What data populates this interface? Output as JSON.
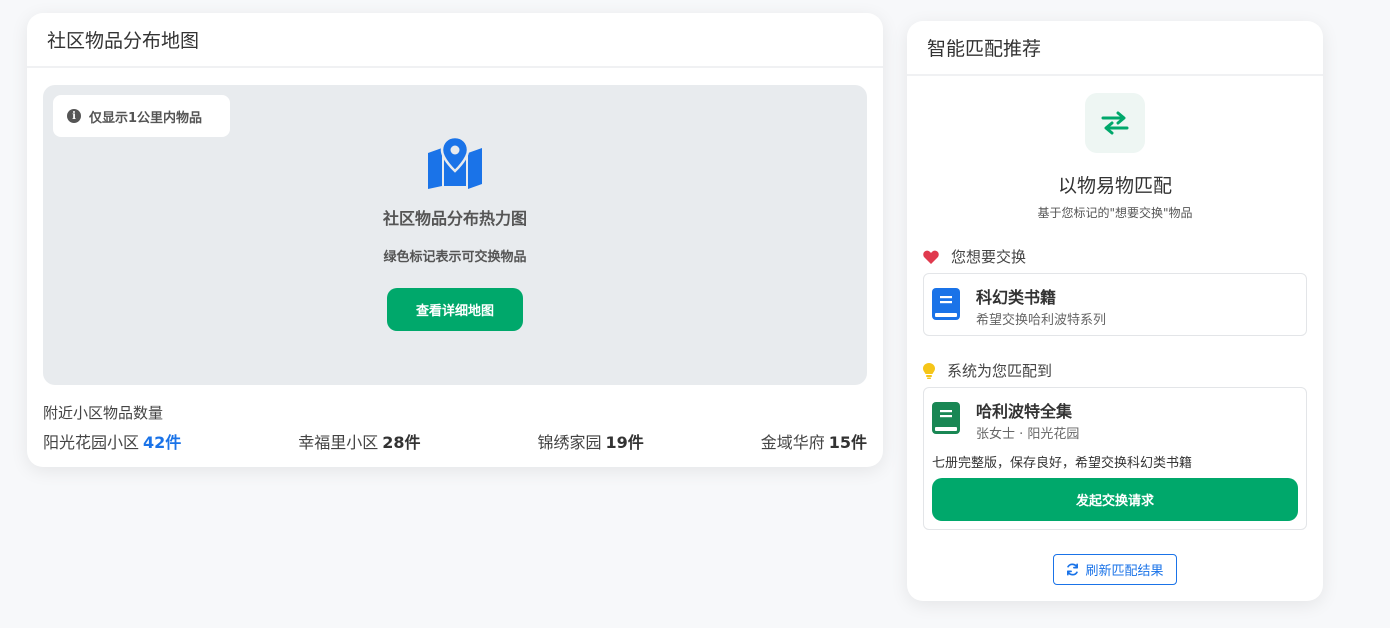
{
  "map_card": {
    "title": "社区物品分布地图",
    "notice": "仅显示1公里内物品",
    "heatmap_title": "社区物品分布热力图",
    "heatmap_sub": "绿色标记表示可交换物品",
    "detail_button": "查看详细地图",
    "stats_title": "附近小区物品数量",
    "stats": [
      {
        "name": "阳光花园小区",
        "count": "42件",
        "highlight": true
      },
      {
        "name": "幸福里小区",
        "count": "28件",
        "highlight": false
      },
      {
        "name": "锦绣家园",
        "count": "19件",
        "highlight": false
      },
      {
        "name": "金域华府",
        "count": "15件",
        "highlight": false
      }
    ]
  },
  "match_card": {
    "title": "智能匹配推荐",
    "heading": "以物易物匹配",
    "subheading": "基于您标记的\"想要交换\"物品",
    "want_label": "您想要交换",
    "want_item": {
      "name": "科幻类书籍",
      "desc": "希望交换哈利波特系列"
    },
    "matched_label": "系统为您匹配到",
    "matched_item": {
      "name": "哈利波特全集",
      "owner": "张女士 · 阳光花园",
      "note": "七册完整版，保存良好，希望交换科幻类书籍"
    },
    "request_button": "发起交换请求",
    "refresh_button": "刷新匹配结果"
  },
  "colors": {
    "green": "#00a86b",
    "blue": "#1a73e8",
    "red_heart": "#e03a4e",
    "bulb": "#f5c518"
  },
  "icons": [
    "info-icon",
    "map-pin-icon",
    "swap-icon",
    "heart-icon",
    "book-icon",
    "lightbulb-icon",
    "refresh-icon"
  ]
}
